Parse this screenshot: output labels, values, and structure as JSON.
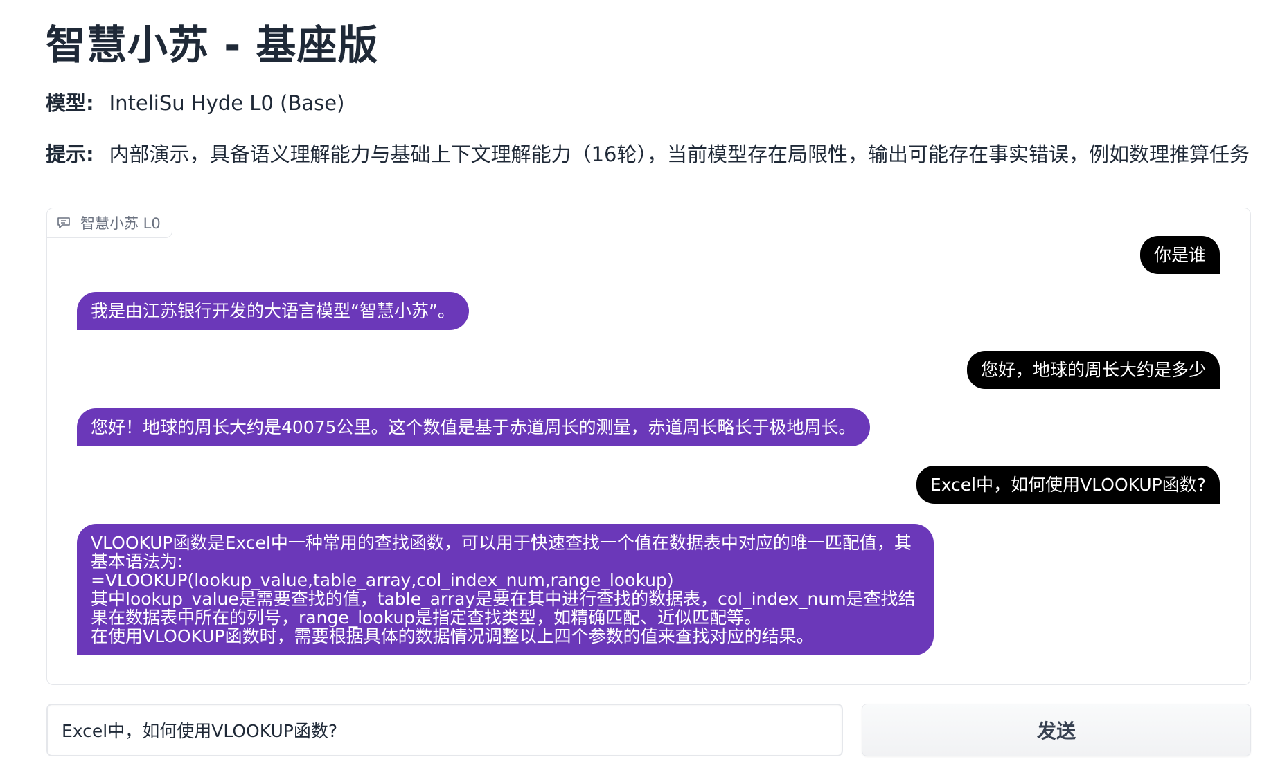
{
  "header": {
    "title": "智慧小苏 - 基座版",
    "model_label": "模型:",
    "model_value": "InteliSu Hyde L0 (Base)",
    "hint_label": "提示:",
    "hint_value": "内部演示，具备语义理解能力与基础上下文理解能力（16轮），当前模型存在局限性，输出可能存在事实错误，例如数理推算任务"
  },
  "chat": {
    "tab_label": "智慧小苏 L0",
    "tab_icon": "chat-bubble-icon",
    "messages": [
      {
        "role": "user",
        "lines": [
          "你是谁"
        ]
      },
      {
        "role": "bot",
        "lines": [
          "我是由江苏银行开发的大语言模型“智慧小苏”。"
        ]
      },
      {
        "role": "user",
        "lines": [
          "您好，地球的周长大约是多少"
        ]
      },
      {
        "role": "bot",
        "lines": [
          "您好！地球的周长大约是40075公里。这个数值是基于赤道周长的测量，赤道周长略长于极地周长。"
        ]
      },
      {
        "role": "user",
        "lines": [
          "Excel中，如何使用VLOOKUP函数?"
        ]
      },
      {
        "role": "bot",
        "lines": [
          "VLOOKUP函数是Excel中一种常用的查找函数，可以用于快速查找一个值在数据表中对应的唯一匹配值，其基本语法为:",
          "=VLOOKUP(lookup_value,table_array,col_index_num,range_lookup)",
          "其中lookup_value是需要查找的值，table_array是要在其中进行查找的数据表，col_index_num是查找结果在数据表中所在的列号，range_lookup是指定查找类型，如精确匹配、近似匹配等。",
          "在使用VLOOKUP函数时，需要根据具体的数据情况调整以上四个参数的值来查找对应的结果。"
        ]
      }
    ]
  },
  "composer": {
    "input_value": "Excel中，如何使用VLOOKUP函数?",
    "send_label": "发送"
  },
  "colors": {
    "user_bubble": "#000000",
    "bot_bubble": "#6b38b9",
    "border": "#e5e7eb"
  }
}
